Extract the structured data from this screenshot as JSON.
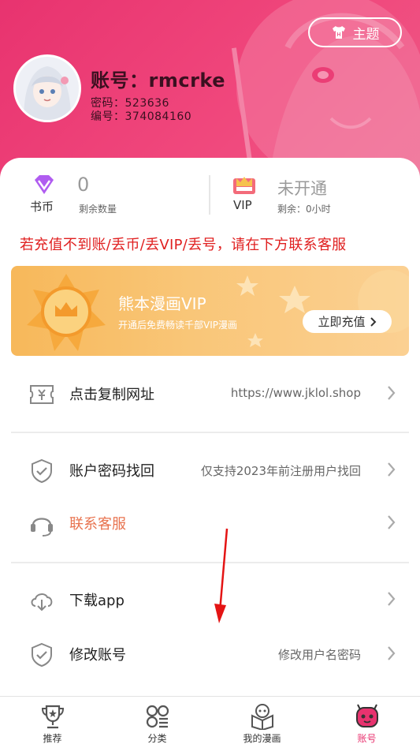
{
  "header": {
    "theme_label": "主题",
    "account": "账号：rmcrke",
    "password_line": "密码：523636",
    "id_line": "编号：374084160"
  },
  "stats": {
    "coin_label": "书币",
    "coin_value": "0",
    "coin_sub": "剩余数量",
    "vip_label": "VIP",
    "vip_value": "未开通",
    "vip_sub": "剩余：0小时"
  },
  "notice": "若充值不到账/丢币/丢VIP/丢号，请在下方联系客服",
  "banner": {
    "title": "熊本漫画VIP",
    "subtitle": "开通后免费畅读千部VIP漫画",
    "button": "立即充值"
  },
  "menu": [
    {
      "label": "点击复制网址",
      "value": "https://www.jklol.shop"
    },
    {
      "label": "账户密码找回",
      "value": "仅支持2023年前注册用户找回"
    },
    {
      "label": "联系客服",
      "value": ""
    },
    {
      "label": "下载app",
      "value": ""
    },
    {
      "label": "修改账号",
      "value": "修改用户名密码"
    }
  ],
  "tabs": [
    {
      "label": "推荐",
      "icon": "trophy-icon"
    },
    {
      "label": "分类",
      "icon": "category-icon"
    },
    {
      "label": "我的漫画",
      "icon": "bookshelf-icon"
    },
    {
      "label": "账号",
      "icon": "account-icon"
    }
  ],
  "colors": {
    "brand": "#e8336f",
    "notice": "#e02020",
    "service": "#e8734f"
  }
}
